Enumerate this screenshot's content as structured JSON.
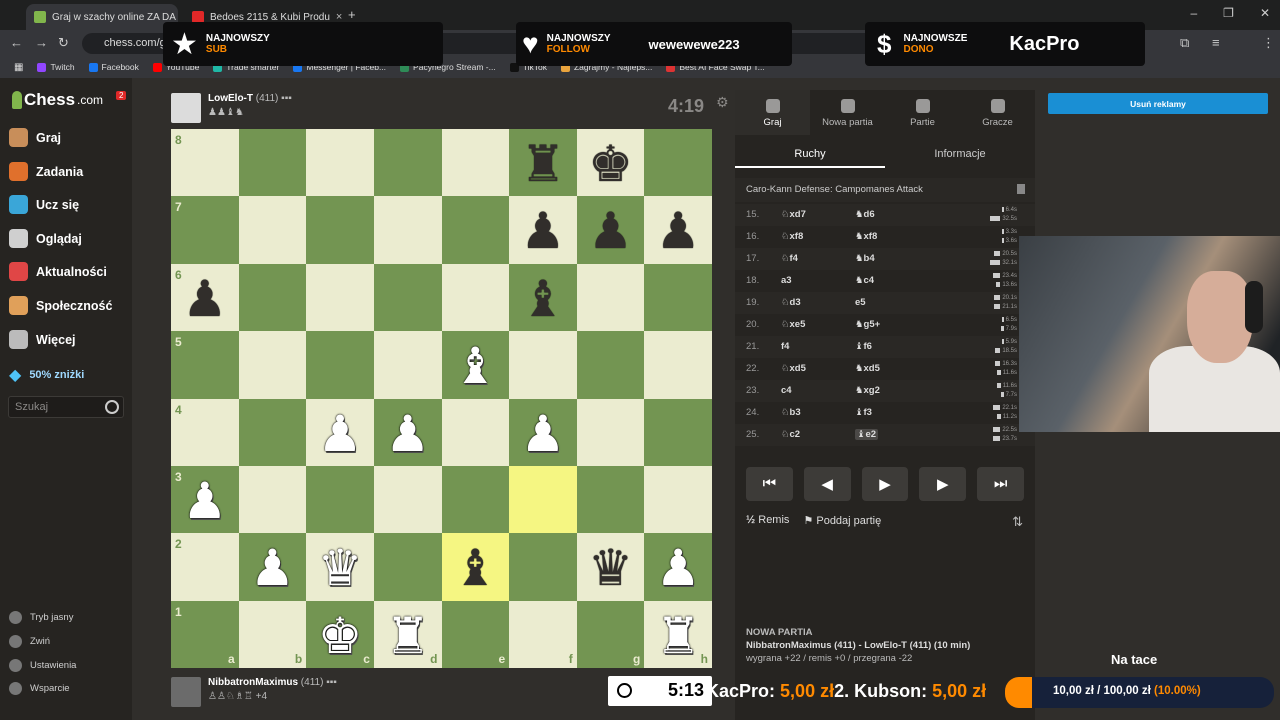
{
  "browser": {
    "tabs": [
      {
        "title": "Graj w szachy online ZA DA",
        "fav": "#81b64c",
        "active": true
      },
      {
        "title": "Bedoes 2115 & Kubi Produ",
        "fav": "#e02828",
        "active": false
      }
    ],
    "url": "chess.com/ga",
    "bookmarks": [
      {
        "label": "Twitch",
        "color": "#9146ff"
      },
      {
        "label": "Facebook",
        "color": "#1877f2"
      },
      {
        "label": "YouTube",
        "color": "#ff0000"
      },
      {
        "label": "Trade smarter",
        "color": "#1fb8a6"
      },
      {
        "label": "Messenger | Faceb...",
        "color": "#1877f2"
      },
      {
        "label": "Pacynegro Stream -...",
        "color": "#2e8b57"
      },
      {
        "label": "TikTok",
        "color": "#111111"
      },
      {
        "label": "Zagrajmy - Najleps...",
        "color": "#e8a33d"
      },
      {
        "label": "Best AI Face Swap T...",
        "color": "#d33"
      }
    ]
  },
  "alerts": {
    "sub": {
      "line1": "NAJNOWSZY",
      "line2": "SUB",
      "name": ""
    },
    "follow": {
      "line1": "NAJNOWSZY",
      "line2": "FOLLOW",
      "name": "wewewewe223"
    },
    "dono": {
      "line1": "NAJNOWSZE",
      "line2": "DONO",
      "name": "KacPro"
    }
  },
  "sidebar": {
    "logo": "Chess",
    "logo_suffix": ".com",
    "badge": "2",
    "items": [
      {
        "label": "Graj",
        "icon": "pawn-play-icon",
        "color": "#c88e5a"
      },
      {
        "label": "Zadania",
        "icon": "puzzle-icon",
        "color": "#e0702c"
      },
      {
        "label": "Ucz się",
        "icon": "graduation-cap-icon",
        "color": "#3aa6d8"
      },
      {
        "label": "Oglądaj",
        "icon": "binoculars-icon",
        "color": "#cfcfcf"
      },
      {
        "label": "Aktualności",
        "icon": "news-icon",
        "color": "#e04646"
      },
      {
        "label": "Społeczność",
        "icon": "community-icon",
        "color": "#e0a05a"
      },
      {
        "label": "Więcej",
        "icon": "more-icon",
        "color": "#bbbbbb"
      }
    ],
    "promo": "50% zniżki",
    "search_placeholder": "Szukaj",
    "bottom": [
      {
        "label": "Tryb jasny",
        "icon": "light-mode-icon"
      },
      {
        "label": "Zwiń",
        "icon": "collapse-icon"
      },
      {
        "label": "Ustawienia",
        "icon": "settings-icon"
      },
      {
        "label": "Wsparcie",
        "icon": "support-icon"
      }
    ]
  },
  "top_player": {
    "name": "LowElo-T",
    "rating": "(411)",
    "captured": "♟♟♝♞",
    "clock": "4:19"
  },
  "bottom_player": {
    "name": "NibbatronMaximus",
    "rating": "(411)",
    "captured": "♙♙♘♗♖ +4",
    "clock": "5:13"
  },
  "board": {
    "rows": [
      [
        "",
        "",
        "",
        "",
        "",
        "r",
        "k",
        ""
      ],
      [
        "",
        "",
        "",
        "",
        "",
        "p",
        "p",
        "p"
      ],
      [
        "p",
        "",
        "",
        "",
        "",
        "b",
        "",
        ""
      ],
      [
        "",
        "",
        "",
        "",
        "B",
        "",
        "",
        ""
      ],
      [
        "",
        "",
        "P",
        "P",
        "",
        "P",
        "",
        ""
      ],
      [
        "P",
        "",
        "",
        "",
        "",
        "",
        "",
        ""
      ],
      [
        "",
        "P",
        "Q",
        "",
        "b",
        "",
        "q",
        "P"
      ],
      [
        "",
        "",
        "K",
        "R",
        "",
        "",
        "",
        "R"
      ]
    ],
    "highlight": [
      [
        5,
        5
      ],
      [
        6,
        4
      ]
    ],
    "files": [
      "a",
      "b",
      "c",
      "d",
      "e",
      "f",
      "g",
      "h"
    ],
    "ranks": [
      "8",
      "7",
      "6",
      "5",
      "4",
      "3",
      "2",
      "1"
    ]
  },
  "panel": {
    "tabs": [
      {
        "label": "Graj",
        "icon": "stopwatch-icon"
      },
      {
        "label": "Nowa partia",
        "icon": "plus-icon"
      },
      {
        "label": "Partie",
        "icon": "board-icon"
      },
      {
        "label": "Gracze",
        "icon": "players-icon"
      }
    ],
    "subtabs": [
      "Ruchy",
      "Informacje"
    ],
    "opening": "Caro-Kann Defense: Campomanes Attack",
    "moves": [
      {
        "n": "15.",
        "w": "♘xd7",
        "b": "♞d6",
        "tw": "6.4s",
        "tb": "32.5s",
        "fw": 0.05,
        "fb": 0.4
      },
      {
        "n": "16.",
        "w": "♘xf8",
        "b": "♞xf8",
        "tw": "3.3s",
        "tb": "3.6s",
        "fw": 0.03,
        "fb": 0.04
      },
      {
        "n": "17.",
        "w": "♘f4",
        "b": "♞b4",
        "tw": "20.5s",
        "tb": "32.1s",
        "fw": 0.25,
        "fb": 0.4
      },
      {
        "n": "18.",
        "w": "a3",
        "b": "♞c4",
        "tw": "23.4s",
        "tb": "13.6s",
        "fw": 0.3,
        "fb": 0.17
      },
      {
        "n": "19.",
        "w": "♘d3",
        "b": "e5",
        "tw": "20.1s",
        "tb": "21.1s",
        "fw": 0.25,
        "fb": 0.26
      },
      {
        "n": "20.",
        "w": "♘xe5",
        "b": "♞g5+",
        "tw": "6.5s",
        "tb": "7.9s",
        "fw": 0.08,
        "fb": 0.1
      },
      {
        "n": "21.",
        "w": "f4",
        "b": "♝f6",
        "tw": "5.9s",
        "tb": "18.5s",
        "fw": 0.07,
        "fb": 0.23
      },
      {
        "n": "22.",
        "w": "♘xd5",
        "b": "♞xd5",
        "tw": "16.3s",
        "tb": "11.6s",
        "fw": 0.2,
        "fb": 0.14
      },
      {
        "n": "23.",
        "w": "c4",
        "b": "♞xg2",
        "tw": "11.6s",
        "tb": "7.7s",
        "fw": 0.14,
        "fb": 0.1
      },
      {
        "n": "24.",
        "w": "♘b3",
        "b": "♝f3",
        "tw": "22.1s",
        "tb": "11.2s",
        "fw": 0.28,
        "fb": 0.14
      },
      {
        "n": "25.",
        "w": "♘c2",
        "b": "♝e2",
        "tw": "22.5s",
        "tb": "23.7s",
        "fw": 0.28,
        "fb": 0.3
      }
    ],
    "controls": [
      "⏮",
      "◀",
      "▶",
      "▶",
      "⏭"
    ],
    "draw": "Remis",
    "draw_prefix": "½",
    "resign": "Poddaj partię",
    "new_game_heading": "NOWA PARTIA",
    "players_line": "NibbatronMaximus (411) - LowElo-T (411) (10 min)",
    "result_line": "wygrana +22 / remis +0 / przegrana -22"
  },
  "ad_button": "Usuń reklamy",
  "stream": {
    "natace": "Na tace",
    "ticker": {
      "name1": "KacPro:",
      "amt1": "5,00 zł",
      "name2": "2. Kubson:",
      "amt2": "5,00 zł"
    },
    "goal": {
      "text": "10,00 zł / 100,00 zł",
      "pct": "(10.00%)",
      "fraction": 0.1
    }
  },
  "colors": {
    "board_light": "#ebecd0",
    "board_dark": "#739552",
    "highlight": "#f5f682",
    "accent": "#ff8a00"
  }
}
